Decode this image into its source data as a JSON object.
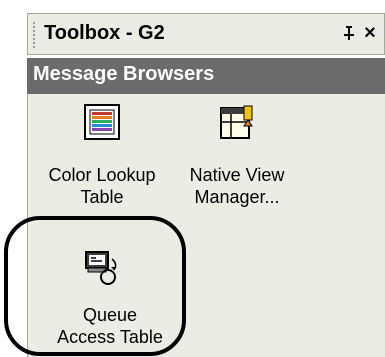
{
  "toolbox": {
    "title": "Toolbox - G2",
    "pin_glyph": "⊥",
    "close_glyph": "×"
  },
  "group": {
    "header": "Message Browsers"
  },
  "items": [
    {
      "label": "Color Lookup\nTable",
      "icon": "color-lookup-table-icon"
    },
    {
      "label": "Native View\nManager...",
      "icon": "native-view-manager-icon"
    },
    {
      "label": "Queue\nAccess Table",
      "icon": "queue-access-table-icon"
    }
  ],
  "colors": {
    "title_bg": "#ecebe4",
    "group_header_bg": "#6b6b6b",
    "panel_bg": "#ecebe4"
  }
}
